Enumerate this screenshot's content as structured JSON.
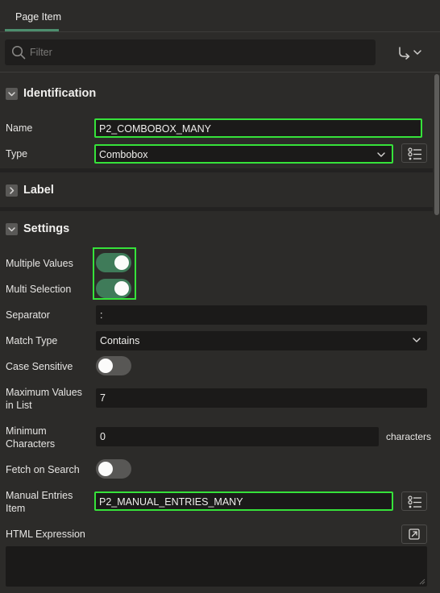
{
  "tabs": {
    "active_label": "Page Item"
  },
  "search": {
    "placeholder": "Filter"
  },
  "sections": {
    "identification": "Identification",
    "label": "Label",
    "settings": "Settings"
  },
  "identification": {
    "name_label": "Name",
    "name_value": "P2_COMBOBOX_MANY",
    "type_label": "Type",
    "type_value": "Combobox"
  },
  "settings": {
    "multiple_values_label": "Multiple Values",
    "multiple_values_on": true,
    "multi_selection_label": "Multi Selection",
    "multi_selection_on": true,
    "separator_label": "Separator",
    "separator_value": ":",
    "match_type_label": "Match Type",
    "match_type_value": "Contains",
    "case_sensitive_label": "Case Sensitive",
    "case_sensitive_on": false,
    "max_values_label_1": "Maximum Values",
    "max_values_label_2": "in List",
    "max_values_value": "7",
    "min_chars_label_1": "Minimum",
    "min_chars_label_2": "Characters",
    "min_chars_value": "0",
    "min_chars_suffix": "characters",
    "fetch_on_search_label": "Fetch on Search",
    "fetch_on_search_on": false,
    "manual_entries_label_1": "Manual Entries",
    "manual_entries_label_2": "Item",
    "manual_entries_value": "P2_MANUAL_ENTRIES_MANY",
    "html_expression_label": "HTML Expression"
  },
  "colors": {
    "highlight": "#36e23a",
    "toggle_on": "#3f7b59",
    "tab_underline": "#4d8e6e"
  }
}
